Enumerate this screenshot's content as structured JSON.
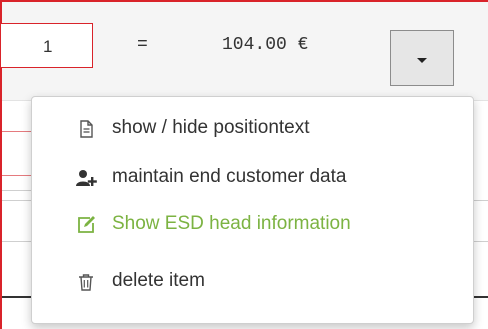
{
  "position_row": {
    "quantity": "1",
    "equals": "=",
    "total_price": "104.00 €"
  },
  "dropdown_menu": {
    "items": [
      {
        "label": "show / hide positiontext",
        "icon": "document-icon"
      },
      {
        "label": "maintain end customer data",
        "icon": "add-user-icon"
      },
      {
        "label": "Show ESD head information",
        "icon": "edit-icon",
        "color": "#7cb342"
      },
      {
        "label": "delete item",
        "icon": "trash-icon"
      }
    ]
  },
  "colors": {
    "accent_red": "#d9232a",
    "highlight_green": "#7cb342"
  }
}
